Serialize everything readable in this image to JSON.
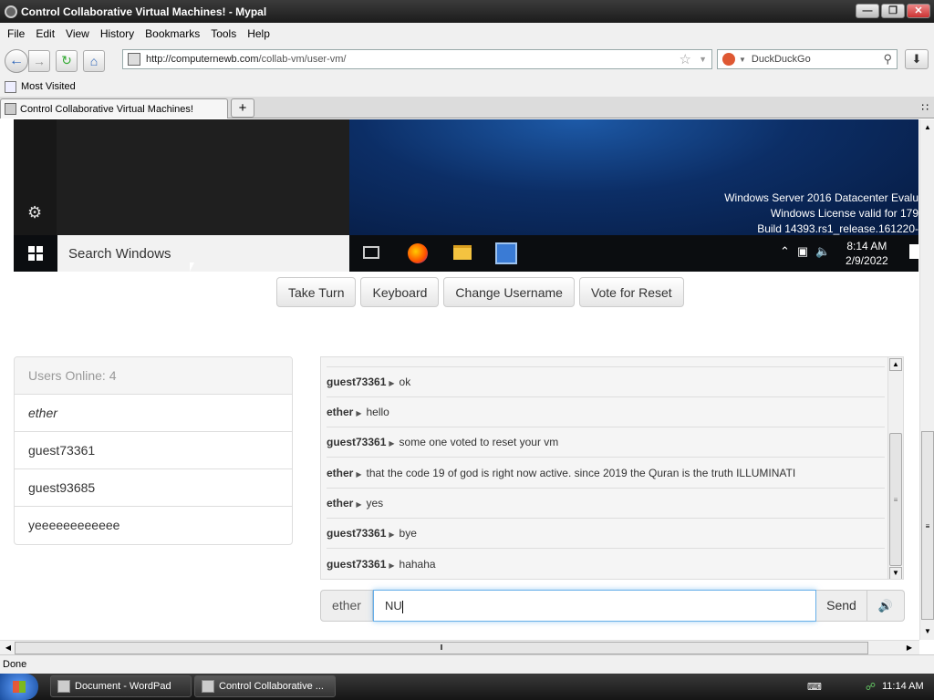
{
  "window": {
    "title": "Control Collaborative Virtual Machines! - Mypal"
  },
  "menu": [
    "File",
    "Edit",
    "View",
    "History",
    "Bookmarks",
    "Tools",
    "Help"
  ],
  "nav": {
    "url_host": "http://computernewb.com",
    "url_path": "/collab-vm/user-vm/",
    "search_placeholder": "DuckDuckGo"
  },
  "bookmarks": {
    "most_visited": "Most Visited"
  },
  "tabs": [
    {
      "label": "Control Collaborative Virtual Machines!"
    }
  ],
  "vm": {
    "search_text": "Search Windows",
    "watermark": [
      "Windows Server 2016 Datacenter Evalu",
      "Windows License valid for 179",
      "Build 14393.rs1_release.161220-"
    ],
    "clock_time": "8:14 AM",
    "clock_date": "2/9/2022"
  },
  "buttons": {
    "take_turn": "Take Turn",
    "keyboard": "Keyboard",
    "change_username": "Change Username",
    "vote_reset": "Vote for Reset"
  },
  "users": {
    "header": "Users Online: 4",
    "list": [
      "ether",
      "guest73361",
      "guest93685",
      "yeeeeeeeeeeee"
    ]
  },
  "chat": {
    "messages": [
      {
        "user": "guest73361",
        "text": "ok"
      },
      {
        "user": "ether",
        "text": "hello"
      },
      {
        "user": "guest73361",
        "text": "some one voted to reset your vm"
      },
      {
        "user": "ether",
        "text": "that the code 19 of god is right now active. since 2019 the Quran is the truth ILLUMINATI"
      },
      {
        "user": "ether",
        "text": "yes"
      },
      {
        "user": "guest73361",
        "text": "bye"
      },
      {
        "user": "guest73361",
        "text": "hahaha"
      }
    ],
    "username": "ether",
    "input_value": "NU",
    "send_label": "Send"
  },
  "status": {
    "text": "Done"
  },
  "taskbar": {
    "tasks": [
      "Document - WordPad",
      "Control Collaborative ..."
    ],
    "clock": "11:14 AM"
  }
}
